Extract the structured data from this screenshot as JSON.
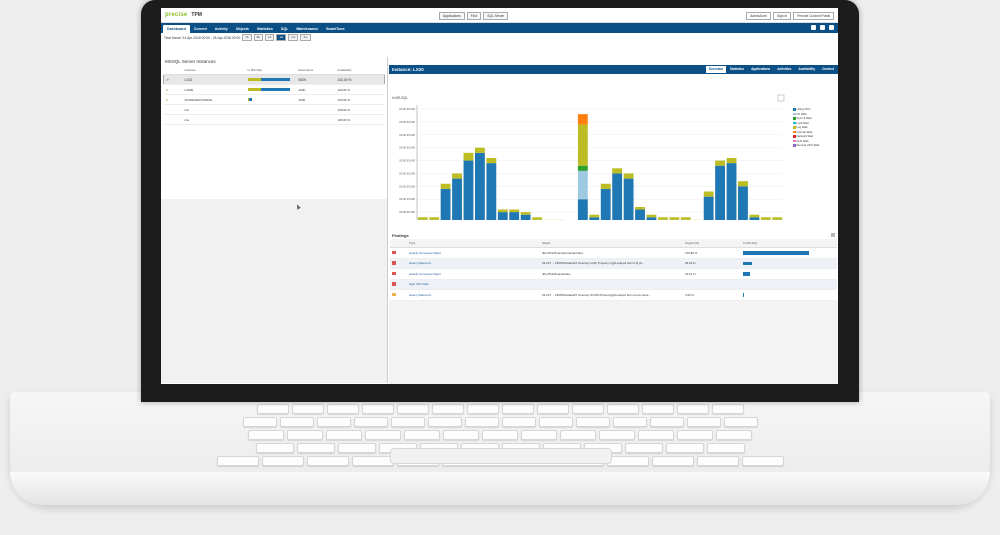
{
  "app": {
    "logo": "precise",
    "product": "TPM"
  },
  "topbar": {
    "selectors": [
      "Applications",
      "Find",
      "SQL Server"
    ],
    "right_buttons": [
      "AdminZone",
      "Sign In",
      "Precise Custom Portal"
    ]
  },
  "nav": {
    "tabs": [
      "Dashboard",
      "Current",
      "Activity",
      "Objects",
      "Statistics",
      "SQL",
      "Maintenance",
      "SmartTune"
    ],
    "active": 0
  },
  "timeframe": {
    "label": "Time frame: 24-Apr-2018 00:00 - 25-Apr-2018 00:00",
    "zoom": [
      "1h",
      "6h",
      "1d",
      "1w",
      "1m",
      "3m"
    ],
    "active_zoom": 2
  },
  "left": {
    "title": "MSSQL Server Instances",
    "columns": [
      "Instance",
      "In MS-SQL",
      "Executions",
      "Availability"
    ],
    "rows": [
      {
        "name": "LX20",
        "in_mssql": 0.52,
        "exec": "500K",
        "avail": "100.00 %"
      },
      {
        "name": "LX500",
        "in_mssql": 0.52,
        "exec": "400K",
        "avail": "100.00 %"
      },
      {
        "name": "SOURCEINSTANCE",
        "in_mssql": 0.05,
        "exec": "2000",
        "avail": "100.00 %"
      },
      {
        "name": "n/a",
        "in_mssql": 0,
        "exec": "",
        "avail": "100.00 %"
      },
      {
        "name": "n/a",
        "in_mssql": 0,
        "exec": "",
        "avail": "100.00 %"
      }
    ]
  },
  "right": {
    "title": "Instance: LX20",
    "tabs": [
      "Overview",
      "Statistics",
      "Applications",
      "Activities",
      "Availability",
      "Context"
    ],
    "active": 0
  },
  "chart_data": {
    "type": "bar",
    "stacked": true,
    "title": "",
    "ylabel": "In MS-SQL",
    "ylim": [
      0,
      45
    ],
    "y_ticks": [
      "00:00:00.000",
      "00:00:05.000",
      "00:00:10.000",
      "00:00:15.000",
      "00:00:20.000",
      "00:00:25.000",
      "00:00:30.000",
      "00:00:35.000",
      "00:00:40.000",
      "00:00:45.000"
    ],
    "legend_position": "right",
    "series": [
      {
        "name": "Using CPU",
        "color": "#1f77b4"
      },
      {
        "name": "I/O Wait",
        "color": "#9ecae1"
      },
      {
        "name": "Sync & Wait",
        "color": "#2ca02c"
      },
      {
        "name": "Lock Wait",
        "color": "#17becf"
      },
      {
        "name": "Log Wait",
        "color": "#bcbd22"
      },
      {
        "name": "Internal Wait",
        "color": "#ff7f0e"
      },
      {
        "name": "Network Wait",
        "color": "#d62728"
      },
      {
        "name": "CLR Wait",
        "color": "#e377c2"
      },
      {
        "name": "Remote CPU Wait",
        "color": "#9467bd"
      }
    ],
    "bars": [
      [
        2,
        0,
        0,
        0,
        1
      ],
      [
        2,
        0,
        0,
        0,
        1
      ],
      [
        14,
        0,
        0,
        0,
        2
      ],
      [
        18,
        0,
        0,
        0,
        2
      ],
      [
        25,
        0,
        0,
        0,
        3
      ],
      [
        28,
        0,
        0,
        0,
        2
      ],
      [
        24,
        0,
        0,
        0,
        2
      ],
      [
        5,
        0,
        0,
        0,
        1
      ],
      [
        5,
        0,
        0,
        0,
        1
      ],
      [
        4,
        0,
        0,
        0,
        1
      ],
      [
        2,
        0,
        0,
        0,
        1
      ],
      [
        1,
        0,
        0,
        0,
        1
      ],
      [
        1,
        0,
        0,
        0,
        1
      ],
      [
        1,
        0,
        0,
        0,
        0.5
      ],
      [
        10,
        11,
        2,
        0,
        16,
        4
      ],
      [
        3,
        0,
        0,
        0,
        1
      ],
      [
        14,
        0,
        0,
        0,
        2
      ],
      [
        20,
        0,
        0,
        0,
        2
      ],
      [
        18,
        0,
        0,
        0,
        2
      ],
      [
        6,
        0,
        0,
        0,
        1
      ],
      [
        3,
        0,
        0,
        0,
        1
      ],
      [
        2,
        0,
        0,
        0,
        1
      ],
      [
        2,
        0,
        0,
        0,
        1
      ],
      [
        2,
        0,
        0,
        0,
        1
      ],
      [
        1,
        0,
        0,
        0,
        1
      ],
      [
        11,
        0,
        0,
        0,
        2
      ],
      [
        23,
        0,
        0,
        0,
        2
      ],
      [
        24,
        0,
        0,
        0,
        2
      ],
      [
        15,
        0,
        0,
        0,
        2
      ],
      [
        3,
        0,
        0,
        0,
        1
      ],
      [
        2,
        0,
        0,
        0,
        1
      ],
      [
        2,
        0,
        0,
        0,
        1
      ]
    ]
  },
  "findings": {
    "title": "Findings",
    "columns": [
      "Type",
      "Object",
      "Impact (%)",
      "In MS-SQL"
    ],
    "rows": [
      {
        "sev": "red",
        "type": "Heavily Accessed Object",
        "object": "dbo.PS125.sandComputerIndex",
        "impact": "270.86 %",
        "bar": 1.0
      },
      {
        "sev": "red",
        "type": "Heavy Statement",
        "object": "22-16T ... FROM RelatedIX Inventory LI(H) Property L(@Lookup4 Item.2.5) [G...",
        "impact": "35.18 %",
        "bar": 0.13
      },
      {
        "sev": "red",
        "type": "Heavily Accessed Object",
        "object": "dbo.PS125.sandIndex",
        "impact": "21.16 %",
        "bar": 0.1
      },
      {
        "sev": "red",
        "type": "High CPU Rate",
        "object": "",
        "impact": "",
        "bar": 0
      },
      {
        "sev": "yellow",
        "type": "Heavy Statement",
        "object": "22-16T ... FROM RelatedIX Inventory IN-500 Property(@Lookup4 Item.4.out) cente...",
        "impact": "4.93 %",
        "bar": 0.02
      }
    ]
  }
}
